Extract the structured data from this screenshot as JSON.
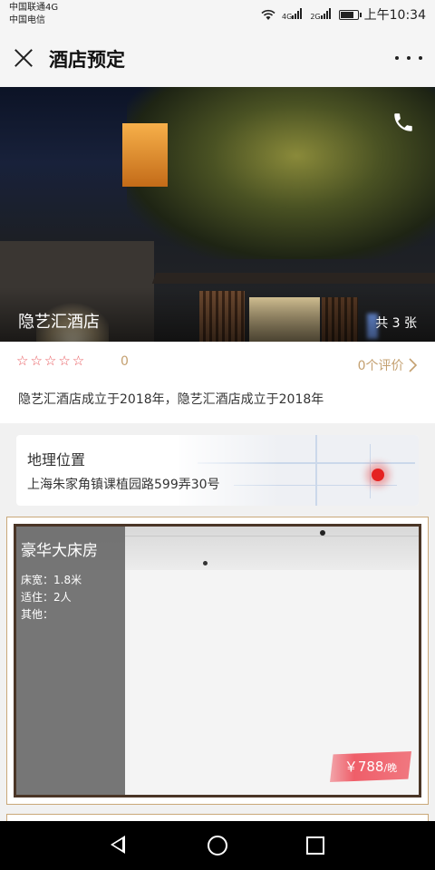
{
  "status_bar": {
    "carrier_1": "中国联通4G",
    "carrier_2": "中国电信",
    "signal_1": "4G",
    "signal_2": "2G",
    "time": "上午10:34"
  },
  "nav": {
    "title": "酒店预定"
  },
  "hotel": {
    "name": "隐艺汇酒店",
    "photo_count": "共 3 张",
    "stars": "☆☆☆☆☆",
    "score": "0",
    "reviews": "0个评价",
    "description": "隐艺汇酒店成立于2018年，隐艺汇酒店成立于2018年"
  },
  "location": {
    "title": "地理位置",
    "address": "上海朱家角镇课植园路599弄30号"
  },
  "room": {
    "name": "豪华大床房",
    "bed_width": "床宽：1.8米",
    "capacity": "适住：2人",
    "other": "其他：",
    "price": "￥788",
    "price_unit": "/晚"
  },
  "colors": {
    "accent_gold": "#c4a070",
    "star_red": "#e8555a",
    "price_red": "#ef5e69",
    "frame_brown": "#4a3526"
  }
}
